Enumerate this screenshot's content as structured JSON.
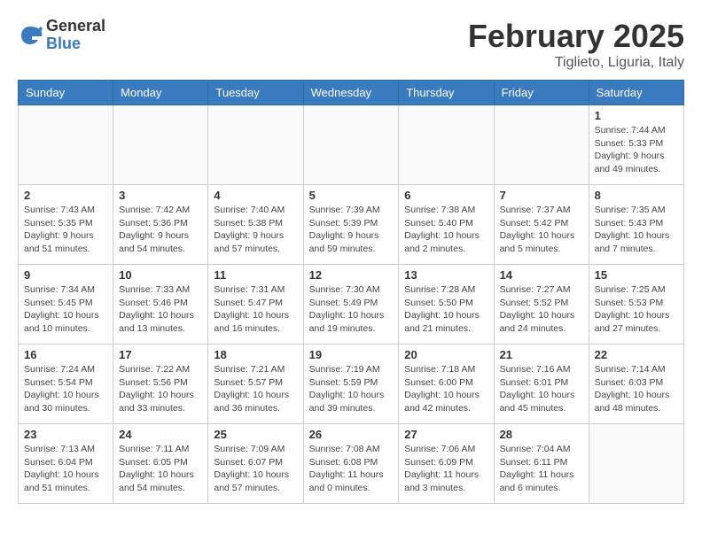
{
  "logo": {
    "general": "General",
    "blue": "Blue"
  },
  "header": {
    "month": "February 2025",
    "location": "Tiglieto, Liguria, Italy"
  },
  "weekdays": [
    "Sunday",
    "Monday",
    "Tuesday",
    "Wednesday",
    "Thursday",
    "Friday",
    "Saturday"
  ],
  "weeks": [
    [
      {
        "day": "",
        "info": ""
      },
      {
        "day": "",
        "info": ""
      },
      {
        "day": "",
        "info": ""
      },
      {
        "day": "",
        "info": ""
      },
      {
        "day": "",
        "info": ""
      },
      {
        "day": "",
        "info": ""
      },
      {
        "day": "1",
        "info": "Sunrise: 7:44 AM\nSunset: 5:33 PM\nDaylight: 9 hours and 49 minutes."
      }
    ],
    [
      {
        "day": "2",
        "info": "Sunrise: 7:43 AM\nSunset: 5:35 PM\nDaylight: 9 hours and 51 minutes."
      },
      {
        "day": "3",
        "info": "Sunrise: 7:42 AM\nSunset: 5:36 PM\nDaylight: 9 hours and 54 minutes."
      },
      {
        "day": "4",
        "info": "Sunrise: 7:40 AM\nSunset: 5:38 PM\nDaylight: 9 hours and 57 minutes."
      },
      {
        "day": "5",
        "info": "Sunrise: 7:39 AM\nSunset: 5:39 PM\nDaylight: 9 hours and 59 minutes."
      },
      {
        "day": "6",
        "info": "Sunrise: 7:38 AM\nSunset: 5:40 PM\nDaylight: 10 hours and 2 minutes."
      },
      {
        "day": "7",
        "info": "Sunrise: 7:37 AM\nSunset: 5:42 PM\nDaylight: 10 hours and 5 minutes."
      },
      {
        "day": "8",
        "info": "Sunrise: 7:35 AM\nSunset: 5:43 PM\nDaylight: 10 hours and 7 minutes."
      }
    ],
    [
      {
        "day": "9",
        "info": "Sunrise: 7:34 AM\nSunset: 5:45 PM\nDaylight: 10 hours and 10 minutes."
      },
      {
        "day": "10",
        "info": "Sunrise: 7:33 AM\nSunset: 5:46 PM\nDaylight: 10 hours and 13 minutes."
      },
      {
        "day": "11",
        "info": "Sunrise: 7:31 AM\nSunset: 5:47 PM\nDaylight: 10 hours and 16 minutes."
      },
      {
        "day": "12",
        "info": "Sunrise: 7:30 AM\nSunset: 5:49 PM\nDaylight: 10 hours and 19 minutes."
      },
      {
        "day": "13",
        "info": "Sunrise: 7:28 AM\nSunset: 5:50 PM\nDaylight: 10 hours and 21 minutes."
      },
      {
        "day": "14",
        "info": "Sunrise: 7:27 AM\nSunset: 5:52 PM\nDaylight: 10 hours and 24 minutes."
      },
      {
        "day": "15",
        "info": "Sunrise: 7:25 AM\nSunset: 5:53 PM\nDaylight: 10 hours and 27 minutes."
      }
    ],
    [
      {
        "day": "16",
        "info": "Sunrise: 7:24 AM\nSunset: 5:54 PM\nDaylight: 10 hours and 30 minutes."
      },
      {
        "day": "17",
        "info": "Sunrise: 7:22 AM\nSunset: 5:56 PM\nDaylight: 10 hours and 33 minutes."
      },
      {
        "day": "18",
        "info": "Sunrise: 7:21 AM\nSunset: 5:57 PM\nDaylight: 10 hours and 36 minutes."
      },
      {
        "day": "19",
        "info": "Sunrise: 7:19 AM\nSunset: 5:59 PM\nDaylight: 10 hours and 39 minutes."
      },
      {
        "day": "20",
        "info": "Sunrise: 7:18 AM\nSunset: 6:00 PM\nDaylight: 10 hours and 42 minutes."
      },
      {
        "day": "21",
        "info": "Sunrise: 7:16 AM\nSunset: 6:01 PM\nDaylight: 10 hours and 45 minutes."
      },
      {
        "day": "22",
        "info": "Sunrise: 7:14 AM\nSunset: 6:03 PM\nDaylight: 10 hours and 48 minutes."
      }
    ],
    [
      {
        "day": "23",
        "info": "Sunrise: 7:13 AM\nSunset: 6:04 PM\nDaylight: 10 hours and 51 minutes."
      },
      {
        "day": "24",
        "info": "Sunrise: 7:11 AM\nSunset: 6:05 PM\nDaylight: 10 hours and 54 minutes."
      },
      {
        "day": "25",
        "info": "Sunrise: 7:09 AM\nSunset: 6:07 PM\nDaylight: 10 hours and 57 minutes."
      },
      {
        "day": "26",
        "info": "Sunrise: 7:08 AM\nSunset: 6:08 PM\nDaylight: 11 hours and 0 minutes."
      },
      {
        "day": "27",
        "info": "Sunrise: 7:06 AM\nSunset: 6:09 PM\nDaylight: 11 hours and 3 minutes."
      },
      {
        "day": "28",
        "info": "Sunrise: 7:04 AM\nSunset: 6:11 PM\nDaylight: 11 hours and 6 minutes."
      },
      {
        "day": "",
        "info": ""
      }
    ]
  ]
}
